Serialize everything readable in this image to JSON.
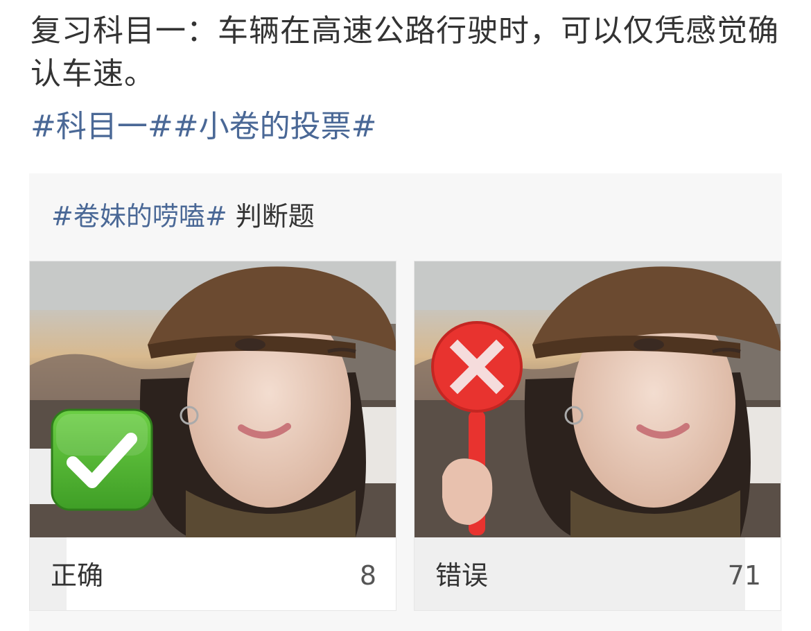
{
  "post": {
    "text": "复习科目一：车辆在高速公路行驶时，可以仅凭感觉确认车速。",
    "topics": [
      "#科目一#",
      "#小卷的投票#"
    ]
  },
  "poll": {
    "topic": "#卷妹的唠嗑#",
    "question_type": "判断题",
    "options": [
      {
        "label": "正确",
        "count": "8",
        "icon": "check-mark-icon",
        "share": 0.1
      },
      {
        "label": "错误",
        "count": "71",
        "icon": "x-sign-paddle-icon",
        "share": 0.9
      }
    ]
  },
  "colors": {
    "topic_link": "#4a6896",
    "body_text": "#333333",
    "card_bg": "#f7f7f7",
    "result_fill": "#efefef",
    "check_green": "#4cae2e",
    "paddle_red": "#e8332f"
  }
}
